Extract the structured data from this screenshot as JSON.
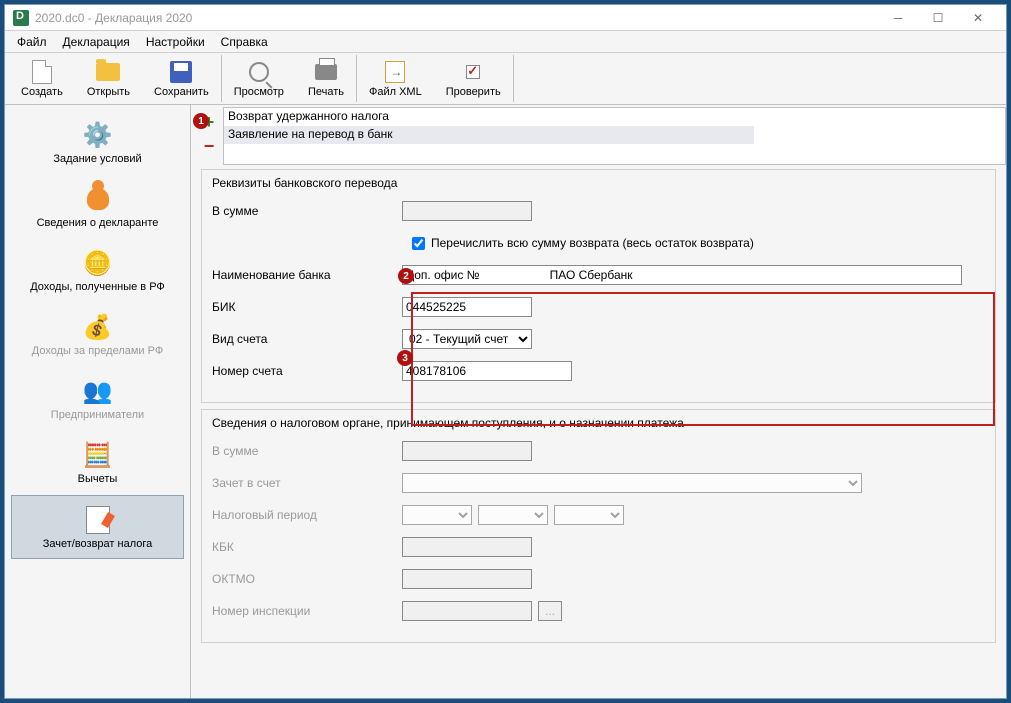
{
  "window": {
    "title": "2020.dc0 - Декларация 2020"
  },
  "menu": {
    "file": "Файл",
    "declaration": "Декларация",
    "settings": "Настройки",
    "help": "Справка"
  },
  "toolbar": {
    "create": "Создать",
    "open": "Открыть",
    "save": "Сохранить",
    "preview": "Просмотр",
    "print": "Печать",
    "xml": "Файл XML",
    "check": "Проверить"
  },
  "sidebar": {
    "conditions": "Задание условий",
    "declarant": "Сведения о декларанте",
    "income_rf": "Доходы, полученные в РФ",
    "income_abroad": "Доходы за пределами РФ",
    "entrepreneurs": "Предприниматели",
    "deductions": "Вычеты",
    "tax_return": "Зачет/возврат налога"
  },
  "list": {
    "row1": "Возврат удержанного налога",
    "row2": "Заявление на перевод в банк"
  },
  "fs1": {
    "title": "Реквизиты банковского перевода",
    "sum_label": "В сумме",
    "sum_value": "",
    "transfer_all": "Перечислить всю сумму возврата (весь остаток возврата)",
    "bank_name_label": "Наименование банка",
    "bank_name_value": "Доп. офис №                     ПАО Сбербанк",
    "bik_label": "БИК",
    "bik_value": "044525225",
    "account_type_label": "Вид счета",
    "account_type_value": "02 - Текущий счет",
    "account_num_label": "Номер счета",
    "account_num_value": "408178106"
  },
  "fs2": {
    "title": "Сведения о налоговом органе, принимающем поступления, и о назначении платежа",
    "sum_label": "В сумме",
    "credit_label": "Зачет в счет",
    "period_label": "Налоговый период",
    "kbk_label": "КБК",
    "oktmo_label": "ОКТМО",
    "inspection_label": "Номер инспекции"
  },
  "badges": {
    "b1": "1",
    "b2": "2",
    "b3": "3"
  }
}
